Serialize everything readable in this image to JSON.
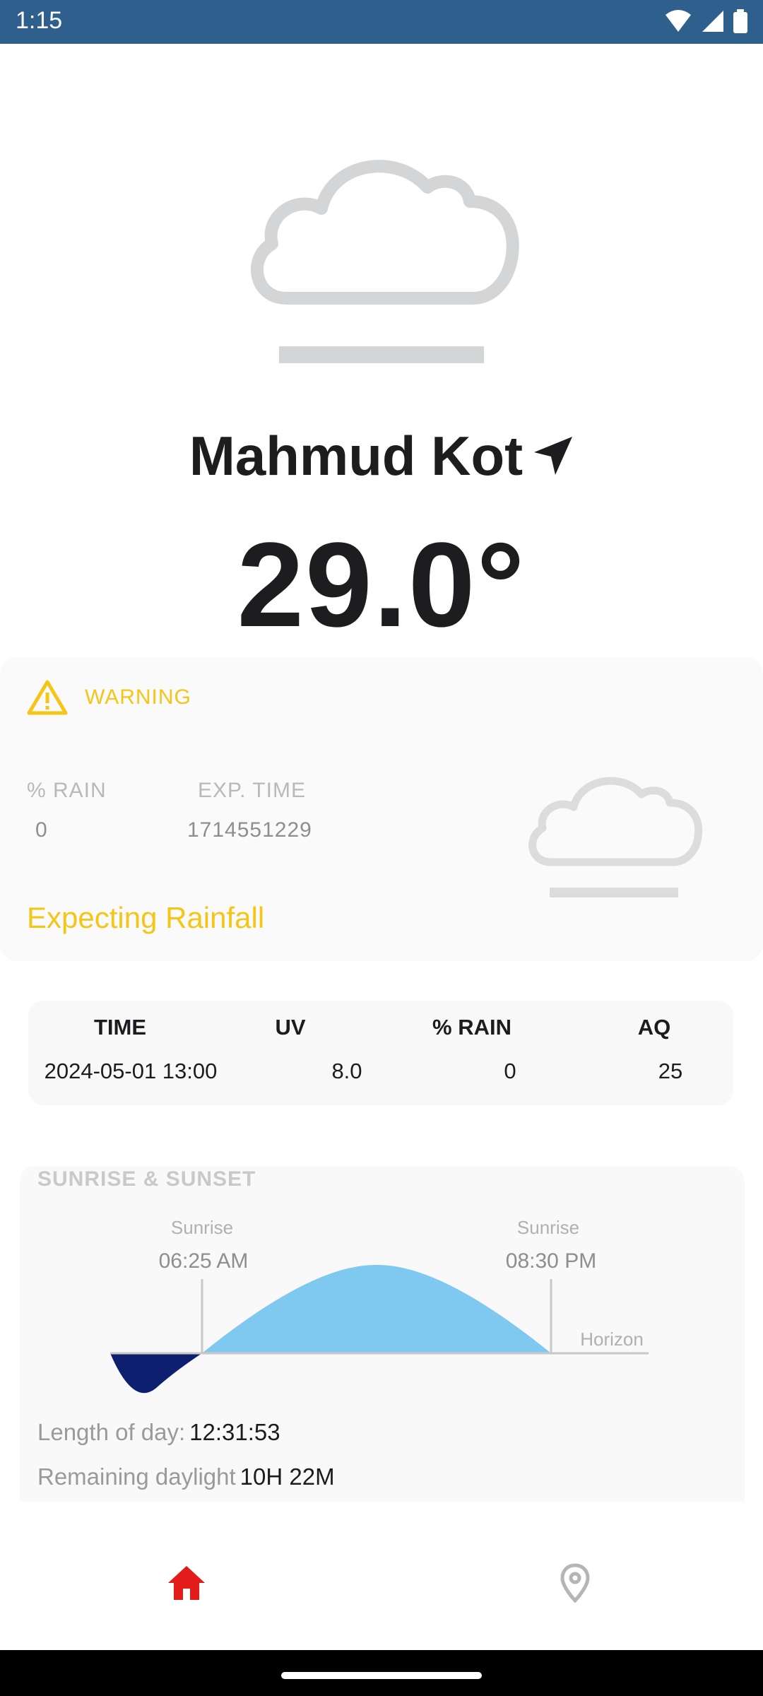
{
  "status_bar": {
    "time": "1:15",
    "icons": [
      "wifi-icon",
      "signal-icon",
      "battery-icon"
    ]
  },
  "location": {
    "city": "Mahmud Kot",
    "icon": "navigation-arrow-icon"
  },
  "current": {
    "temperature": "29.0°",
    "condition_icon": "fog-cloud-icon"
  },
  "warning": {
    "title": "WARNING",
    "rain_label": "% RAIN",
    "rain_value": "0",
    "exp_time_label": "EXP. TIME",
    "exp_time_value": "1714551229",
    "message": "Expecting Rainfall",
    "accent_color": "#f5c518"
  },
  "forecast_table": {
    "headers": [
      "TIME",
      "UV",
      "% RAIN",
      "AQ"
    ],
    "rows": [
      [
        "2024-05-01 13:00",
        "8.0",
        "0",
        "25"
      ]
    ]
  },
  "sun": {
    "title": "SUNRISE & SUNSET",
    "sunrise_label": "Sunrise",
    "sunrise_time": "06:25 AM",
    "sunset_label": "Sunrise",
    "sunset_time": "08:30 PM",
    "horizon_label": "Horizon",
    "length_label": "Length of day:",
    "length_value": "12:31:53",
    "remaining_label": "Remaining daylight",
    "remaining_value": "10H 22M",
    "day_color": "#7fc8f0",
    "night_color": "#0d1f6e"
  },
  "nav": {
    "items": [
      {
        "name": "home",
        "icon": "home-icon",
        "active": true
      },
      {
        "name": "locations",
        "icon": "location-pin-icon",
        "active": false
      }
    ],
    "active_color": "#e31b1b",
    "inactive_color": "#b5b5b5"
  }
}
